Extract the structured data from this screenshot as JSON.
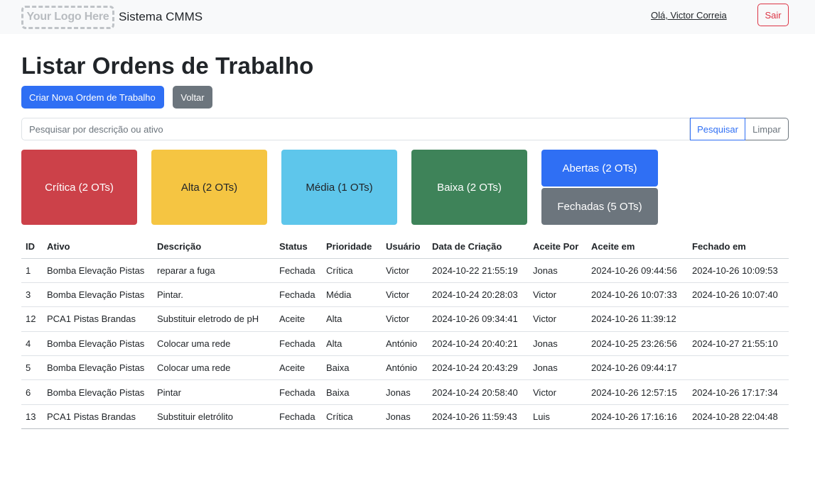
{
  "header": {
    "logo_text": "Your Logo Here",
    "brand": "Sistema CMMS",
    "greeting": "Olá, Victor Correia",
    "logout_label": "Sair"
  },
  "page": {
    "title": "Listar Ordens de Trabalho",
    "create_label": "Criar Nova Ordem de Trabalho",
    "back_label": "Voltar"
  },
  "search": {
    "placeholder": "Pesquisar por descrição ou ativo",
    "search_label": "Pesquisar",
    "clear_label": "Limpar"
  },
  "filters": {
    "critica": "Crítica (2 OTs)",
    "alta": "Alta (2 OTs)",
    "media": "Média (1 OTs)",
    "baixa": "Baixa (2 OTs)",
    "abertas": "Abertas (2 OTs)",
    "fechadas": "Fechadas (5 OTs)"
  },
  "colors": {
    "critica": "#cc4149",
    "alta": "#f5c542",
    "media": "#5ec6eb",
    "baixa": "#3e8359",
    "primary": "#2f6ff4",
    "secondary": "#6c757d",
    "danger": "#dc3545"
  },
  "table": {
    "headers": [
      "ID",
      "Ativo",
      "Descrição",
      "Status",
      "Prioridade",
      "Usuário",
      "Data de Criação",
      "Aceite Por",
      "Aceite em",
      "Fechado em"
    ],
    "rows": [
      [
        "1",
        "Bomba Elevação Pistas",
        "reparar a fuga",
        "Fechada",
        "Crítica",
        "Victor",
        "2024-10-22 21:55:19",
        "Jonas",
        "2024-10-26 09:44:56",
        "2024-10-26 10:09:53"
      ],
      [
        "3",
        "Bomba Elevação Pistas",
        "Pintar.",
        "Fechada",
        "Média",
        "Victor",
        "2024-10-24 20:28:03",
        "Victor",
        "2024-10-26 10:07:33",
        "2024-10-26 10:07:40"
      ],
      [
        "12",
        "PCA1 Pistas Brandas",
        "Substituir eletrodo de pH",
        "Aceite",
        "Alta",
        "Victor",
        "2024-10-26 09:34:41",
        "Victor",
        "2024-10-26 11:39:12",
        ""
      ],
      [
        "4",
        "Bomba Elevação Pistas",
        "Colocar uma rede",
        "Fechada",
        "Alta",
        "António",
        "2024-10-24 20:40:21",
        "Jonas",
        "2024-10-25 23:26:56",
        "2024-10-27 21:55:10"
      ],
      [
        "5",
        "Bomba Elevação Pistas",
        "Colocar uma rede",
        "Aceite",
        "Baixa",
        "António",
        "2024-10-24 20:43:29",
        "Jonas",
        "2024-10-26 09:44:17",
        ""
      ],
      [
        "6",
        "Bomba Elevação Pistas",
        "Pintar",
        "Fechada",
        "Baixa",
        "Jonas",
        "2024-10-24 20:58:40",
        "Victor",
        "2024-10-26 12:57:15",
        "2024-10-26 17:17:34"
      ],
      [
        "13",
        "PCA1 Pistas Brandas",
        "Substituir eletrólito",
        "Fechada",
        "Crítica",
        "Jonas",
        "2024-10-26 11:59:43",
        "Luis",
        "2024-10-26 17:16:16",
        "2024-10-28 22:04:48"
      ]
    ]
  }
}
